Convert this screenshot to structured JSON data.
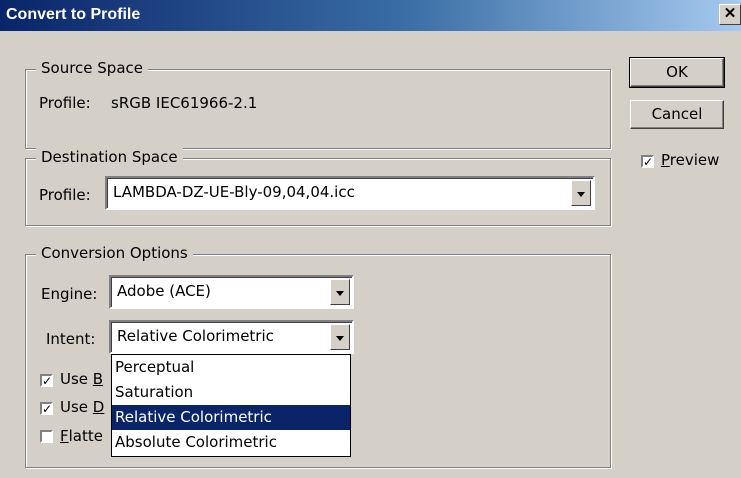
{
  "window": {
    "title": "Convert to Profile",
    "close_glyph": "✕"
  },
  "source": {
    "group_title": "Source Space",
    "profile_label": "Profile:",
    "profile_value": "sRGB IEC61966-2.1"
  },
  "destination": {
    "group_title": "Destination Space",
    "profile_label": "Profile:",
    "profile_value": "LAMBDA-DZ-UE-Bly-09,04,04.icc"
  },
  "conversion": {
    "group_title": "Conversion Options",
    "engine_label": "Engine:",
    "engine_value": "Adobe (ACE)",
    "intent_label": "Intent:",
    "intent_value": "Relative Colorimetric",
    "intent_options": [
      "Perceptual",
      "Saturation",
      "Relative Colorimetric",
      "Absolute Colorimetric"
    ],
    "checkboxes": [
      {
        "label": "Use ",
        "mnemonic": "B",
        "checked": true
      },
      {
        "label": "Use ",
        "mnemonic": "D",
        "checked": true
      },
      {
        "label": "Flatte",
        "mnemonic": "F",
        "checked": false
      }
    ]
  },
  "buttons": {
    "ok": "OK",
    "cancel": "Cancel"
  },
  "preview": {
    "label_mnemonic": "P",
    "label_rest": "review",
    "checked": true
  },
  "colors": {
    "selection": "#0a246a",
    "face": "#d4d0c8"
  }
}
